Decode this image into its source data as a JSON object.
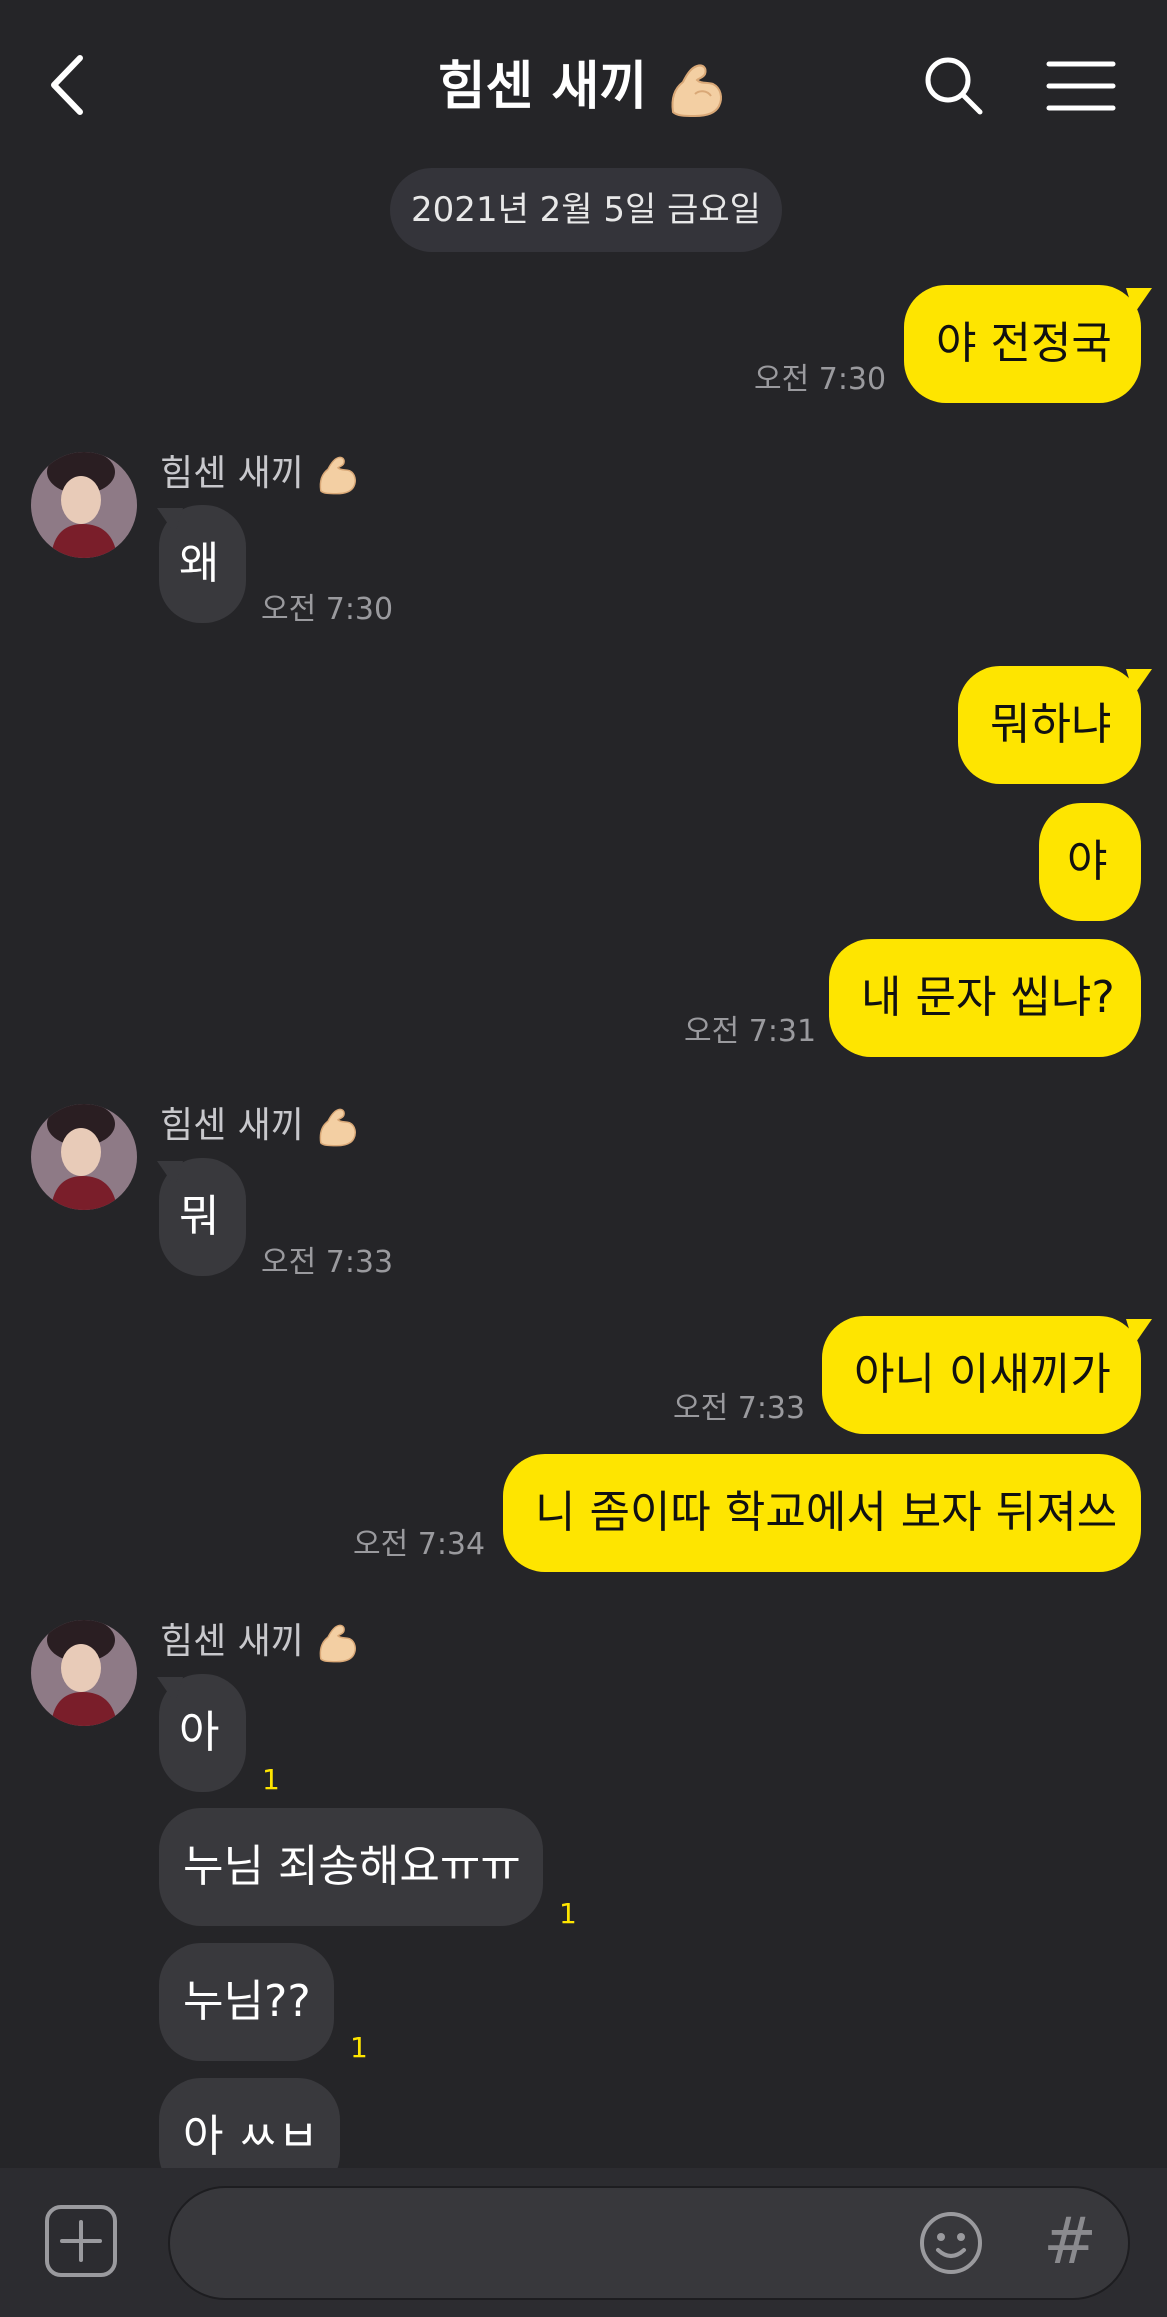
{
  "header": {
    "title": "힘센 새끼",
    "title_emoji": "flexed-biceps-emoji"
  },
  "date_divider": "2021년 2월 5일 금요일",
  "sender_name": "힘센 새끼",
  "messages": [
    {
      "from": "me",
      "text": "야 전정국",
      "time": "오전 7:30"
    },
    {
      "from": "them",
      "text": "왜",
      "time": "오전 7:30"
    },
    {
      "from": "me",
      "text": "뭐하냐"
    },
    {
      "from": "me",
      "text": "야"
    },
    {
      "from": "me",
      "text": "내 문자 씹냐?",
      "time": "오전 7:31"
    },
    {
      "from": "them",
      "text": "뭐",
      "time": "오전 7:33"
    },
    {
      "from": "me",
      "text": "아니 이새끼가",
      "time": "오전 7:33"
    },
    {
      "from": "me",
      "text": "니 좀이따 학교에서 보자 뒤져쓰",
      "time": "오전 7:34"
    },
    {
      "from": "them",
      "text": "아",
      "unread": "1"
    },
    {
      "from": "them",
      "text": "누님 죄송해요ㅠㅠ",
      "unread": "1"
    },
    {
      "from": "them",
      "text": "누님??",
      "unread": "1"
    },
    {
      "from": "them",
      "text": "아 ㅆㅂ"
    }
  ],
  "input": {
    "value": ""
  },
  "icons": {
    "back": "chevron-left-icon",
    "search": "search-icon",
    "menu": "menu-icon",
    "plus": "plus-square-icon",
    "emoji": "smiley-icon",
    "hash": "#"
  },
  "colors": {
    "background": "#252528",
    "my_bubble": "#fee500",
    "their_bubble": "#39393d",
    "timestamp": "#9a9a9e",
    "unread_count": "#fee500"
  }
}
